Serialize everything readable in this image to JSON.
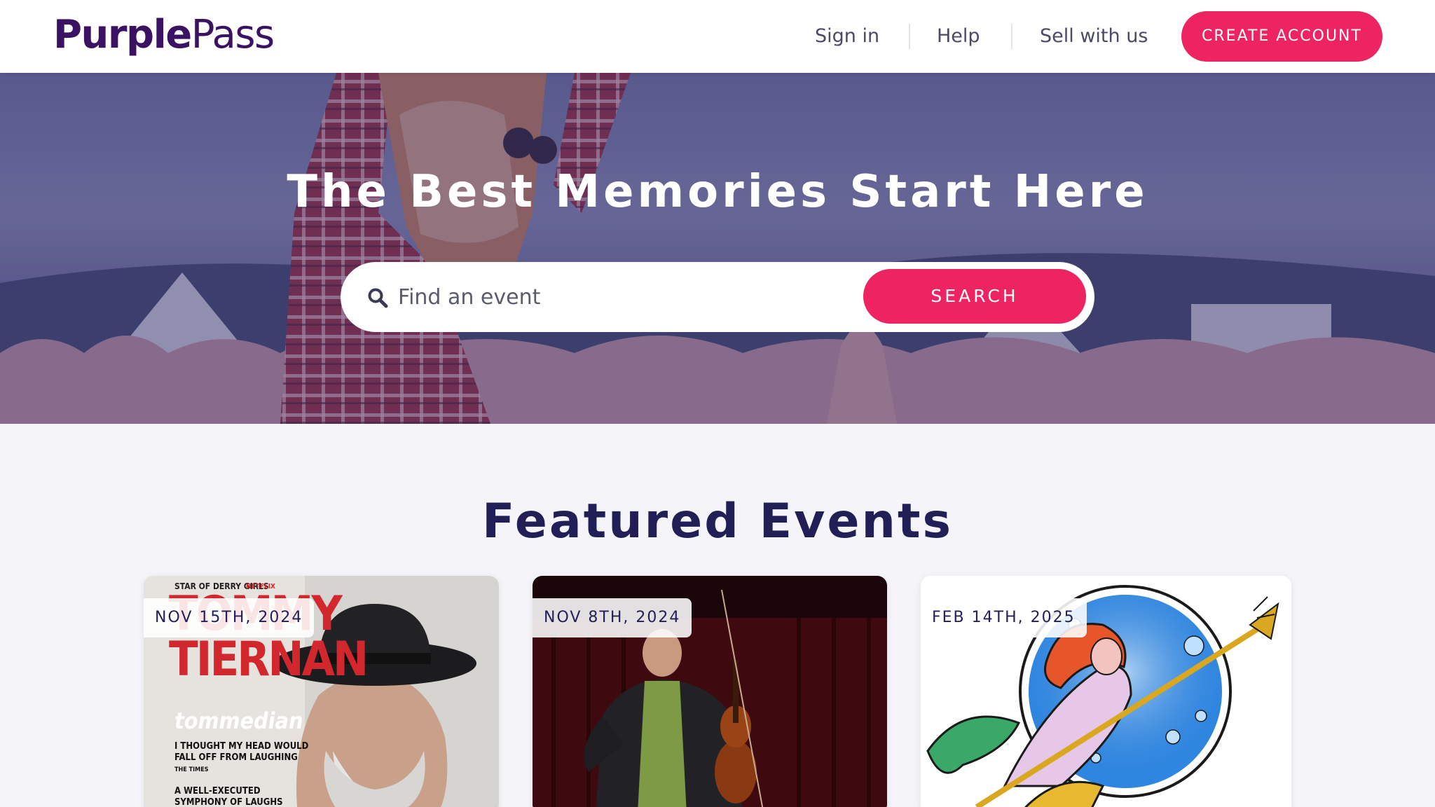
{
  "brand": {
    "part1": "Purple",
    "part2": "Pass"
  },
  "nav": {
    "sign_in": "Sign in",
    "help": "Help",
    "sell": "Sell with us",
    "create_account": "CREATE ACCOUNT"
  },
  "hero": {
    "title": "The Best Memories Start Here",
    "search_placeholder": "Find an event",
    "search_button": "SEARCH"
  },
  "featured": {
    "title": "Featured Events",
    "events": [
      {
        "date": "NOV 15TH, 2024",
        "poster_lines": [
          "STAR OF DERRY GIRLS",
          "NETFLIX",
          "TOMMY",
          "TIERNAN",
          "tommedian",
          "I THOUGHT MY HEAD WOULD",
          "FALL OFF FROM LAUGHING",
          "THE TIMES",
          "A WELL-EXECUTED",
          "SYMPHONY OF LAUGHS"
        ]
      },
      {
        "date": "NOV 8TH, 2024"
      },
      {
        "date": "FEB 14TH, 2025"
      }
    ]
  },
  "colors": {
    "brand_purple": "#3b1263",
    "accent_pink": "#ee2462",
    "navy_text": "#221f57",
    "page_bg": "#f4f4f9"
  },
  "icons": [
    "search-icon"
  ]
}
